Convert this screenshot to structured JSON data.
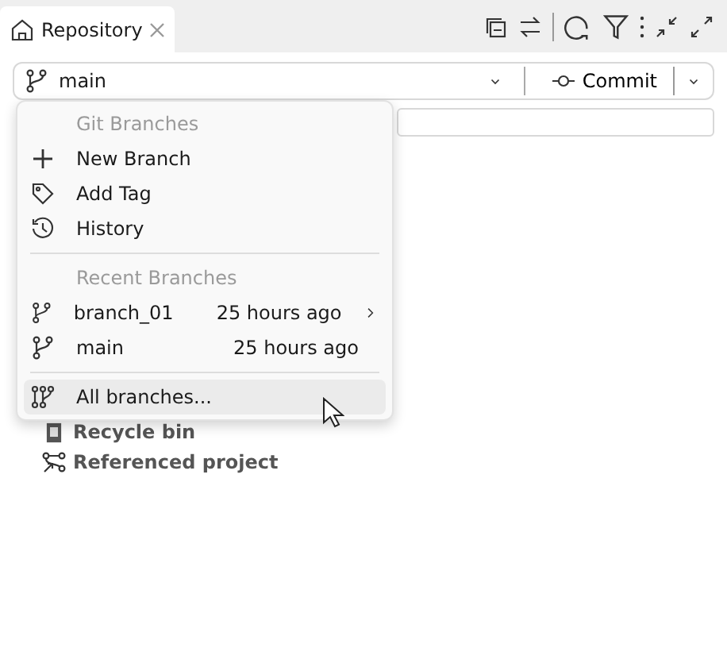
{
  "tab": {
    "label": "Repository"
  },
  "branch_bar": {
    "branch": "main",
    "commit_label": "Commit"
  },
  "tree": [
    {
      "kind": "bin",
      "label": "Recycle bin"
    },
    {
      "kind": "reference",
      "label": "Referenced project"
    }
  ],
  "menu": {
    "sections": [
      {
        "title": "Git Branches",
        "items": [
          {
            "kind": "add",
            "label": "New Branch",
            "highlighted": false
          },
          {
            "kind": "tag",
            "label": "Add Tag",
            "highlighted": false
          },
          {
            "kind": "history",
            "label": "History",
            "highlighted": false
          }
        ]
      },
      {
        "title": "Recent Branches",
        "items": [
          {
            "kind": "branch",
            "label": "branch_01",
            "time": "25 hours ago",
            "submenu": true,
            "highlighted": false
          },
          {
            "kind": "branch",
            "label": "main",
            "time": "25 hours ago",
            "submenu": false,
            "highlighted": false
          }
        ]
      },
      {
        "items": [
          {
            "kind": "branches",
            "label": "All branches...",
            "highlighted": true
          }
        ]
      }
    ]
  }
}
